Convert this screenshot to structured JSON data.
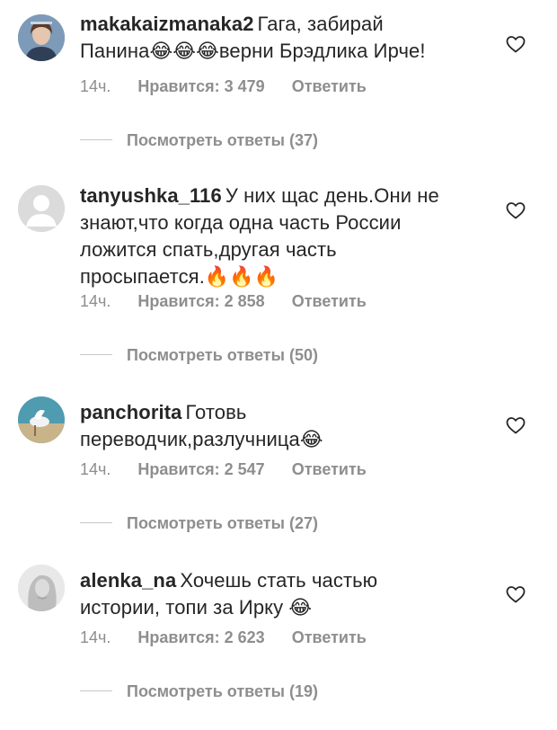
{
  "comments": [
    {
      "username": "makakaizmanaka2",
      "lines": [
        "Гага, забирай",
        "Панина😂😂😂верни Брэдлика Ирче!"
      ],
      "time": "14ч.",
      "likes": "Нравится: 3 479",
      "reply": "Ответить",
      "view_replies": "Посмотреть ответы (37)"
    },
    {
      "username": "tanyushka_116",
      "lines": [
        "У них щас день.Они не",
        "знают,что когда одна часть России",
        "ложится спать,другая часть",
        "просыпается.🔥🔥🔥"
      ],
      "time": "14ч.",
      "likes": "Нравится: 2 858",
      "reply": "Ответить",
      "view_replies": "Посмотреть ответы (50)"
    },
    {
      "username": "panchorita",
      "lines": [
        "Готовь",
        "переводчик,разлучница😂"
      ],
      "time": "14ч.",
      "likes": "Нравится: 2 547",
      "reply": "Ответить",
      "view_replies": "Посмотреть ответы (27)"
    },
    {
      "username": "alenka_na",
      "lines": [
        "Хочешь стать частью",
        "истории, топи за Ирку 😂"
      ],
      "time": "14ч.",
      "likes": "Нравится: 2 623",
      "reply": "Ответить",
      "view_replies": "Посмотреть ответы (19)"
    }
  ],
  "icons": {
    "like": "heart-outline-icon",
    "default_avatar": "default-avatar-icon"
  },
  "colors": {
    "text": "#262626",
    "muted": "#8e8e8e",
    "divider": "#c7c7c7"
  }
}
